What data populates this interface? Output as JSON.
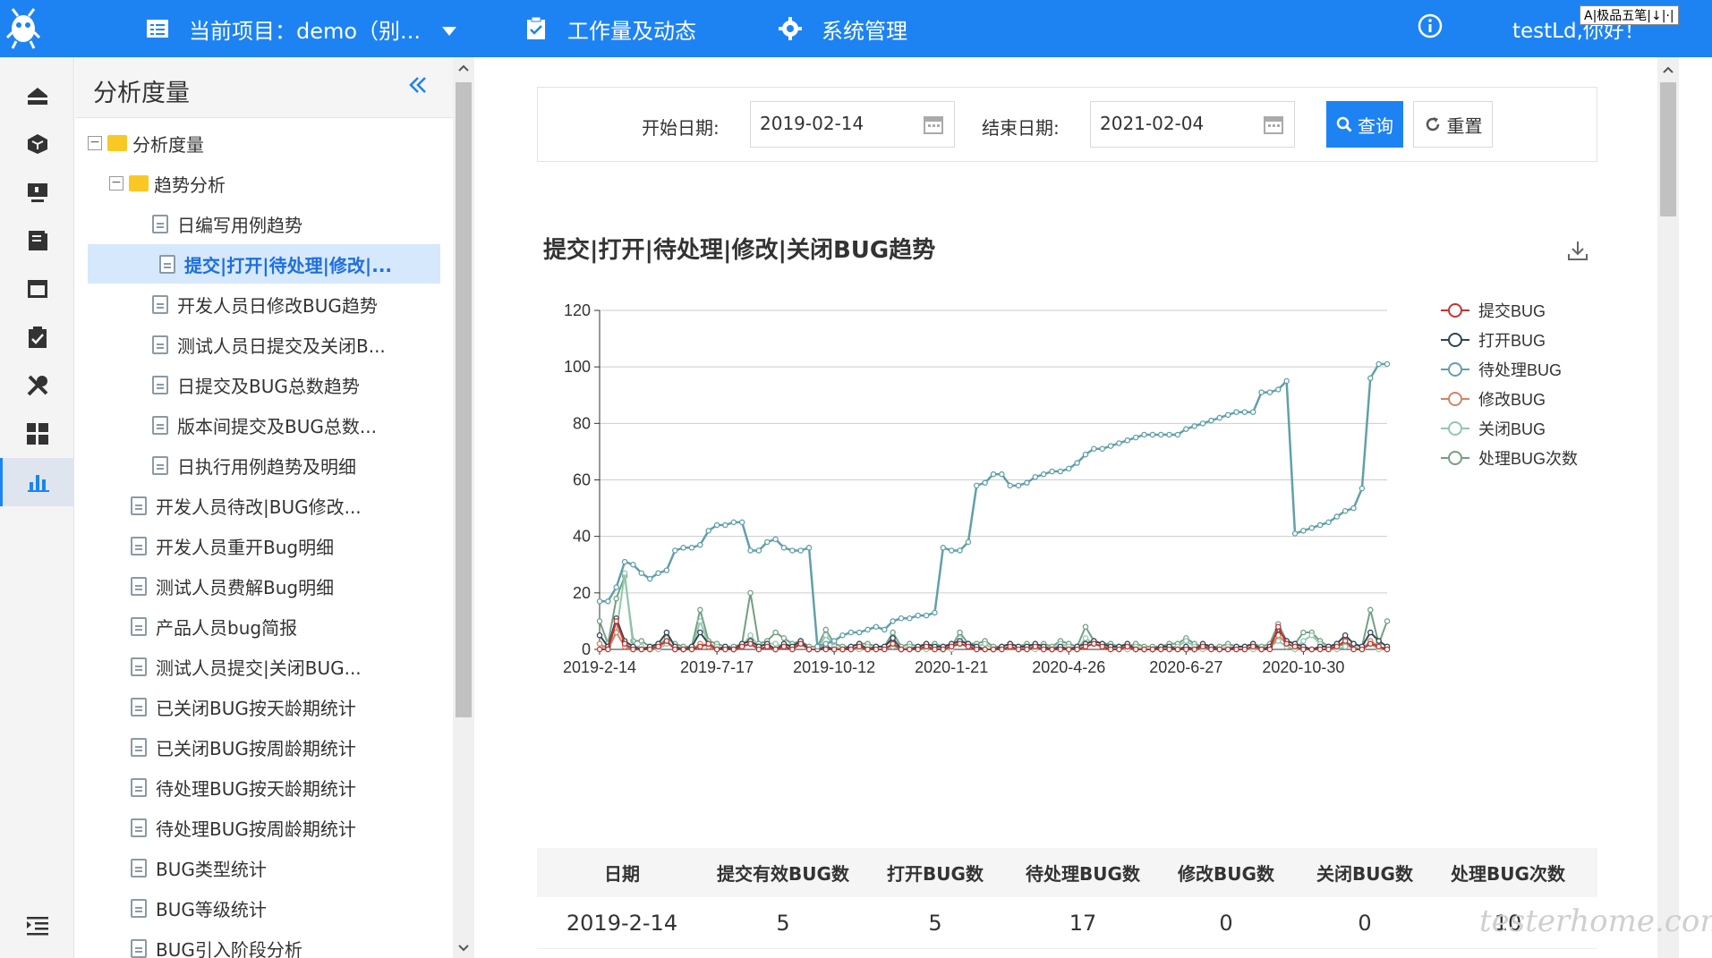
{
  "topbar": {
    "project_label": "当前项目：demo（别...",
    "workload_label": "工作量及动态",
    "system_label": "系统管理",
    "user_label": "testLd,你好！",
    "ime_label": "A|极品五笔|↓|·|",
    "bg_color": "#1d83f3"
  },
  "iconbar": {
    "items": [
      "home-icon",
      "cube-icon",
      "monitor-icon",
      "doc-list-icon",
      "window-icon",
      "checklist-icon",
      "tools-icon",
      "dashboard-icon",
      "bar-chart-icon"
    ],
    "active_index": 8,
    "bottom": "collapse-menu-icon"
  },
  "tree": {
    "title": "分析度量",
    "nodes": [
      {
        "label": "分析度量",
        "type": "folder",
        "level": 0
      },
      {
        "label": "趋势分析",
        "type": "folder",
        "level": 1
      },
      {
        "label": "日编写用例趋势",
        "type": "doc",
        "level": 2
      },
      {
        "label": "提交|打开|待处理|修改|...",
        "type": "doc",
        "level": 2,
        "selected": true
      },
      {
        "label": "开发人员日修改BUG趋势",
        "type": "doc",
        "level": 2
      },
      {
        "label": "测试人员日提交及关闭B...",
        "type": "doc",
        "level": 2
      },
      {
        "label": "日提交及BUG总数趋势",
        "type": "doc",
        "level": 2
      },
      {
        "label": "版本间提交及BUG总数...",
        "type": "doc",
        "level": 2
      },
      {
        "label": "日执行用例趋势及明细",
        "type": "doc",
        "level": 2
      },
      {
        "label": "开发人员待改|BUG修改...",
        "type": "doc",
        "level": 1
      },
      {
        "label": "开发人员重开Bug明细",
        "type": "doc",
        "level": 1
      },
      {
        "label": "测试人员费解Bug明细",
        "type": "doc",
        "level": 1
      },
      {
        "label": "产品人员bug简报",
        "type": "doc",
        "level": 1
      },
      {
        "label": "测试人员提交|关闭BUG...",
        "type": "doc",
        "level": 1
      },
      {
        "label": "已关闭BUG按天龄期统计",
        "type": "doc",
        "level": 1
      },
      {
        "label": "已关闭BUG按周龄期统计",
        "type": "doc",
        "level": 1
      },
      {
        "label": "待处理BUG按天龄期统计",
        "type": "doc",
        "level": 1
      },
      {
        "label": "待处理BUG按周龄期统计",
        "type": "doc",
        "level": 1
      },
      {
        "label": "BUG类型统计",
        "type": "doc",
        "level": 1
      },
      {
        "label": "BUG等级统计",
        "type": "doc",
        "level": 1
      },
      {
        "label": "BUG引入阶段分析",
        "type": "doc",
        "level": 1
      }
    ]
  },
  "filter": {
    "start_label": "开始日期:",
    "start_value": "2019-02-14",
    "end_label": "结束日期:",
    "end_value": "2021-02-04",
    "query_label": "查询",
    "reset_label": "重置"
  },
  "chart_title": "提交|打开|待处理|修改|关闭BUG趋势",
  "chart_data": {
    "type": "line",
    "title": "提交|打开|待处理|修改|关闭BUG趋势",
    "ylim": [
      0,
      120
    ],
    "yticks": [
      0,
      20,
      40,
      60,
      80,
      100,
      120
    ],
    "xtick_labels": [
      "2019-2-14",
      "2019-7-17",
      "2019-10-12",
      "2020-1-21",
      "2020-4-26",
      "2020-6-27",
      "2020-10-30"
    ],
    "n_points": 95,
    "legend_position": "right",
    "grid": true,
    "series": [
      {
        "name": "提交BUG",
        "color": "#c23531",
        "values": [
          0,
          0,
          10,
          2,
          0,
          0,
          0,
          1,
          3,
          0,
          0,
          0,
          1,
          2,
          0,
          0,
          0,
          1,
          2,
          0,
          1,
          0,
          1,
          0,
          2,
          0,
          0,
          0,
          0,
          0,
          0,
          1,
          0,
          0,
          0,
          2,
          0,
          0,
          0,
          1,
          0,
          0,
          1,
          2,
          1,
          0,
          0,
          0,
          0,
          1,
          0,
          0,
          1,
          0,
          0,
          0,
          0,
          0,
          1,
          2,
          1,
          0,
          0,
          1,
          0,
          0,
          0,
          0,
          0,
          0,
          0,
          0,
          1,
          0,
          0,
          0,
          0,
          0,
          1,
          0,
          0,
          8,
          2,
          1,
          0,
          0,
          0,
          0,
          1,
          3,
          0,
          0,
          2,
          1,
          0
        ]
      },
      {
        "name": "打开BUG",
        "color": "#2f4554",
        "values": [
          5,
          1,
          11,
          3,
          1,
          0,
          1,
          2,
          6,
          1,
          0,
          1,
          6,
          2,
          0,
          1,
          0,
          2,
          3,
          1,
          2,
          0,
          2,
          1,
          3,
          0,
          0,
          1,
          0,
          0,
          1,
          2,
          0,
          1,
          1,
          4,
          0,
          0,
          1,
          2,
          1,
          1,
          2,
          3,
          2,
          1,
          0,
          0,
          1,
          2,
          1,
          1,
          2,
          1,
          0,
          1,
          0,
          1,
          2,
          3,
          2,
          1,
          1,
          2,
          0,
          0,
          0,
          1,
          1,
          0,
          1,
          0,
          2,
          1,
          0,
          0,
          1,
          1,
          2,
          0,
          1,
          7,
          3,
          2,
          1,
          0,
          1,
          1,
          2,
          5,
          2,
          1,
          6,
          3,
          1
        ]
      },
      {
        "name": "待处理BUG",
        "color": "#61a0a8",
        "values": [
          17,
          17,
          22,
          31,
          30,
          27,
          25,
          27,
          28,
          35,
          36,
          36,
          37,
          42,
          44,
          44,
          45,
          45,
          35,
          35,
          38,
          39,
          36,
          35,
          35,
          36,
          1,
          2,
          3,
          5,
          6,
          6,
          7,
          8,
          7,
          10,
          11,
          11,
          12,
          12,
          13,
          36,
          35,
          35,
          38,
          58,
          59,
          62,
          62,
          58,
          58,
          59,
          61,
          62,
          63,
          63,
          64,
          66,
          69,
          71,
          71,
          72,
          73,
          74,
          75,
          76,
          76,
          76,
          76,
          76,
          78,
          79,
          80,
          81,
          82,
          83,
          84,
          84,
          84,
          91,
          91,
          92,
          95,
          41,
          42,
          43,
          44,
          45,
          47,
          49,
          50,
          57,
          96,
          101,
          101
        ]
      },
      {
        "name": "修改BUG",
        "color": "#d48265",
        "values": [
          2,
          0,
          6,
          1,
          0,
          0,
          0,
          1,
          3,
          0,
          0,
          0,
          2,
          1,
          0,
          0,
          0,
          1,
          2,
          0,
          1,
          0,
          1,
          0,
          2,
          0,
          0,
          0,
          0,
          0,
          0,
          1,
          0,
          0,
          0,
          2,
          0,
          0,
          0,
          1,
          0,
          0,
          1,
          2,
          1,
          0,
          0,
          0,
          0,
          1,
          0,
          0,
          1,
          0,
          0,
          0,
          0,
          0,
          1,
          2,
          1,
          0,
          0,
          1,
          0,
          0,
          0,
          0,
          0,
          0,
          0,
          0,
          1,
          0,
          0,
          0,
          0,
          0,
          1,
          0,
          0,
          5,
          2,
          1,
          0,
          0,
          0,
          0,
          1,
          3,
          0,
          0,
          3,
          1,
          0
        ]
      },
      {
        "name": "关闭BUG",
        "color": "#91c7ae",
        "values": [
          0,
          2,
          6,
          27,
          1,
          1,
          0,
          0,
          2,
          1,
          0,
          0,
          10,
          2,
          1,
          0,
          0,
          1,
          5,
          1,
          2,
          2,
          1,
          1,
          2,
          0,
          0,
          5,
          1,
          0,
          0,
          0,
          1,
          0,
          0,
          1,
          0,
          1,
          0,
          0,
          1,
          0,
          0,
          4,
          1,
          1,
          2,
          0,
          0,
          1,
          0,
          1,
          0,
          1,
          0,
          2,
          1,
          0,
          4,
          2,
          1,
          1,
          0,
          0,
          1,
          0,
          0,
          0,
          1,
          1,
          3,
          1,
          0,
          0,
          0,
          1,
          0,
          0,
          0,
          0,
          1,
          3,
          1,
          0,
          3,
          5,
          2,
          0,
          0,
          1,
          1,
          0,
          2,
          0,
          1
        ]
      },
      {
        "name": "处理BUG次数",
        "color": "#749f83",
        "values": [
          10,
          2,
          18,
          26,
          3,
          3,
          1,
          1,
          4,
          2,
          1,
          1,
          14,
          3,
          2,
          1,
          1,
          2,
          20,
          2,
          3,
          6,
          4,
          2,
          3,
          1,
          1,
          7,
          2,
          1,
          1,
          2,
          2,
          1,
          1,
          6,
          1,
          2,
          1,
          1,
          2,
          1,
          1,
          6,
          2,
          2,
          3,
          1,
          1,
          2,
          1,
          2,
          1,
          2,
          1,
          3,
          2,
          1,
          8,
          3,
          2,
          2,
          1,
          1,
          2,
          1,
          1,
          1,
          2,
          2,
          4,
          2,
          1,
          1,
          1,
          2,
          1,
          1,
          2,
          1,
          2,
          9,
          3,
          2,
          6,
          6,
          3,
          1,
          1,
          2,
          2,
          1,
          14,
          2,
          10
        ]
      }
    ]
  },
  "table": {
    "headers": [
      "日期",
      "提交有效BUG数",
      "打开BUG数",
      "待处理BUG数",
      "修改BUG数",
      "关闭BUG数",
      "处理BUG次数"
    ],
    "rows": [
      [
        "2019-2-14",
        "5",
        "5",
        "17",
        "0",
        "0",
        "10"
      ]
    ]
  },
  "watermark": "testerhome.com"
}
